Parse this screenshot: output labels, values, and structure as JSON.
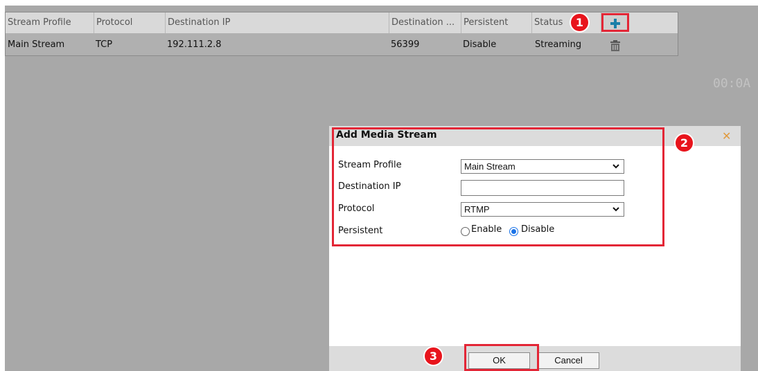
{
  "table": {
    "headers": [
      "Stream Profile",
      "Protocol",
      "Destination IP",
      "Destination ...",
      "Persistent",
      "Status"
    ],
    "rows": [
      {
        "stream_profile": "Main Stream",
        "protocol": "TCP",
        "destination_ip": "192.111.2.8",
        "destination_port": "56399",
        "persistent": "Disable",
        "status": "Streaming"
      }
    ]
  },
  "badges": [
    "1",
    "2",
    "3"
  ],
  "clock": "00:0A",
  "dialog": {
    "title": "Add Media Stream",
    "fields": {
      "stream_profile": {
        "label": "Stream Profile",
        "value": "Main Stream"
      },
      "destination_ip": {
        "label": "Destination IP",
        "value": ""
      },
      "protocol": {
        "label": "Protocol",
        "value": "RTMP"
      },
      "persistent": {
        "label": "Persistent",
        "options": [
          "Enable",
          "Disable"
        ],
        "selected": "Disable"
      }
    },
    "ok_label": "OK",
    "cancel_label": "Cancel"
  },
  "colors": {
    "highlight": "#e32636",
    "add_icon": "#1a7fa8",
    "radio_selected": "#1a73e8"
  }
}
